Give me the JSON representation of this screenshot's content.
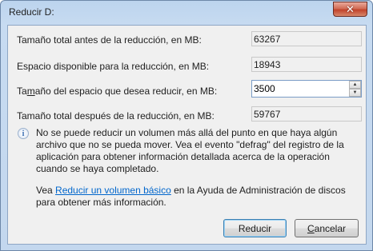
{
  "window": {
    "title": "Reducir D:"
  },
  "fields": {
    "total_before": {
      "label": "Tamaño total antes de la reducción, en MB:",
      "value": "63267"
    },
    "available": {
      "label": "Espacio disponible para la reducción, en MB:",
      "value": "18943"
    },
    "shrink_amount": {
      "label_pre": "Ta",
      "label_hot": "m",
      "label_post": "año del espacio que desea reducir, en MB:",
      "value": "3500"
    },
    "total_after": {
      "label": "Tamaño total después de la reducción, en MB:",
      "value": "59767"
    }
  },
  "info": {
    "text": "No se puede reducir un volumen más allá del punto en que haya algún archivo que no se pueda mover. Vea el evento \"defrag\" del registro de la aplicación para obtener información detallada acerca de la operación cuando se haya completado."
  },
  "help": {
    "prefix": "Vea ",
    "link": "Reducir un volumen básico",
    "suffix": " en la Ayuda de Administración de discos para obtener más información."
  },
  "buttons": {
    "ok_label": "Reducir",
    "cancel_pre": "",
    "cancel_hot": "C",
    "cancel_post": "ancelar"
  },
  "icons": {
    "close": "close-icon",
    "info": "info-icon",
    "spin_up": "chevron-up-icon",
    "spin_down": "chevron-down-icon"
  }
}
